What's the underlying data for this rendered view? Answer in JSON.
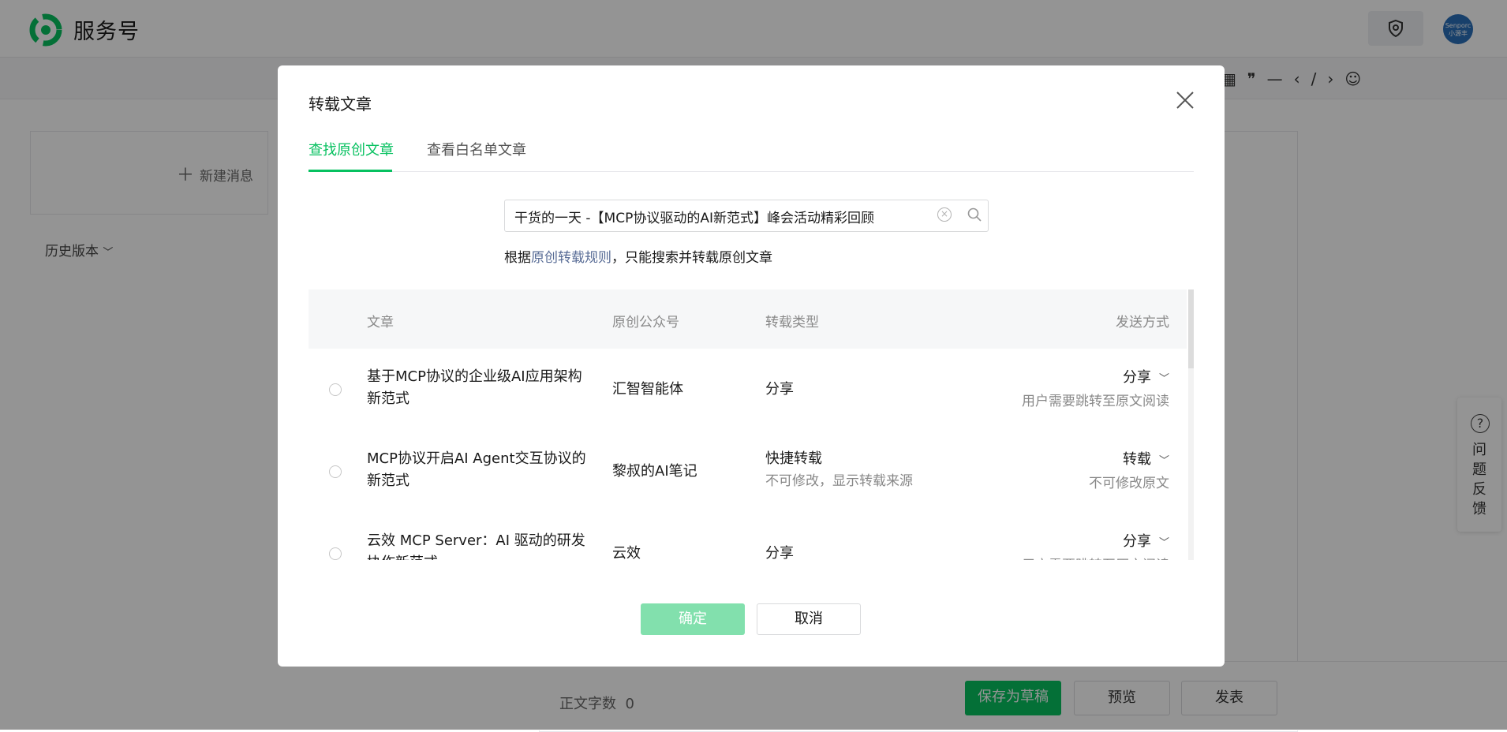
{
  "app": {
    "brand": "服务号",
    "avatar_text": "Senporc 小源丰"
  },
  "editor": {
    "new_message_label": "新建消息",
    "history_label": "历史版本",
    "word_count_label": "正文字数",
    "word_count_value": "0",
    "save_draft_label": "保存为草稿",
    "preview_label": "预览",
    "publish_label": "发表",
    "toolbar_icons": [
      "table-icon",
      "quote-icon",
      "divider-icon",
      "code-icon",
      "emoji-icon"
    ]
  },
  "feedback": {
    "label": "问题反馈"
  },
  "dialog": {
    "title": "转载文章",
    "tabs": [
      {
        "label": "查找原创文章",
        "active": true
      },
      {
        "label": "查看白名单文章",
        "active": false
      }
    ],
    "search": {
      "value": "干货的一天 -【MCP协议驱动的AI新范式】峰会活动精彩回顾"
    },
    "hint": {
      "prefix": "根据",
      "link": "原创转载规则",
      "suffix": "，只能搜索并转载原创文章"
    },
    "table": {
      "headers": [
        "文章",
        "原创公众号",
        "转载类型",
        "发送方式"
      ],
      "rows": [
        {
          "title": "基于MCP协议的企业级AI应用架构新范式",
          "account": "汇智智能体",
          "type": "分享",
          "type_sub": "",
          "send": "分享",
          "send_sub": "用户需要跳转至原文阅读"
        },
        {
          "title": "MCP协议开启AI Agent交互协议的新范式",
          "account": "黎叔的AI笔记",
          "type": "快捷转载",
          "type_sub": "不可修改，显示转载来源",
          "send": "转载",
          "send_sub": "不可修改原文"
        },
        {
          "title": "云效 MCP Server：AI 驱动的研发协作新范式",
          "account": "云效",
          "type": "分享",
          "type_sub": "",
          "send": "分享",
          "send_sub": "用户需要跳转至原文阅读"
        }
      ]
    },
    "confirm_label": "确定",
    "cancel_label": "取消"
  },
  "colors": {
    "accent": "#07c160",
    "accent_disabled": "#82e0ad",
    "link": "#576b95"
  }
}
